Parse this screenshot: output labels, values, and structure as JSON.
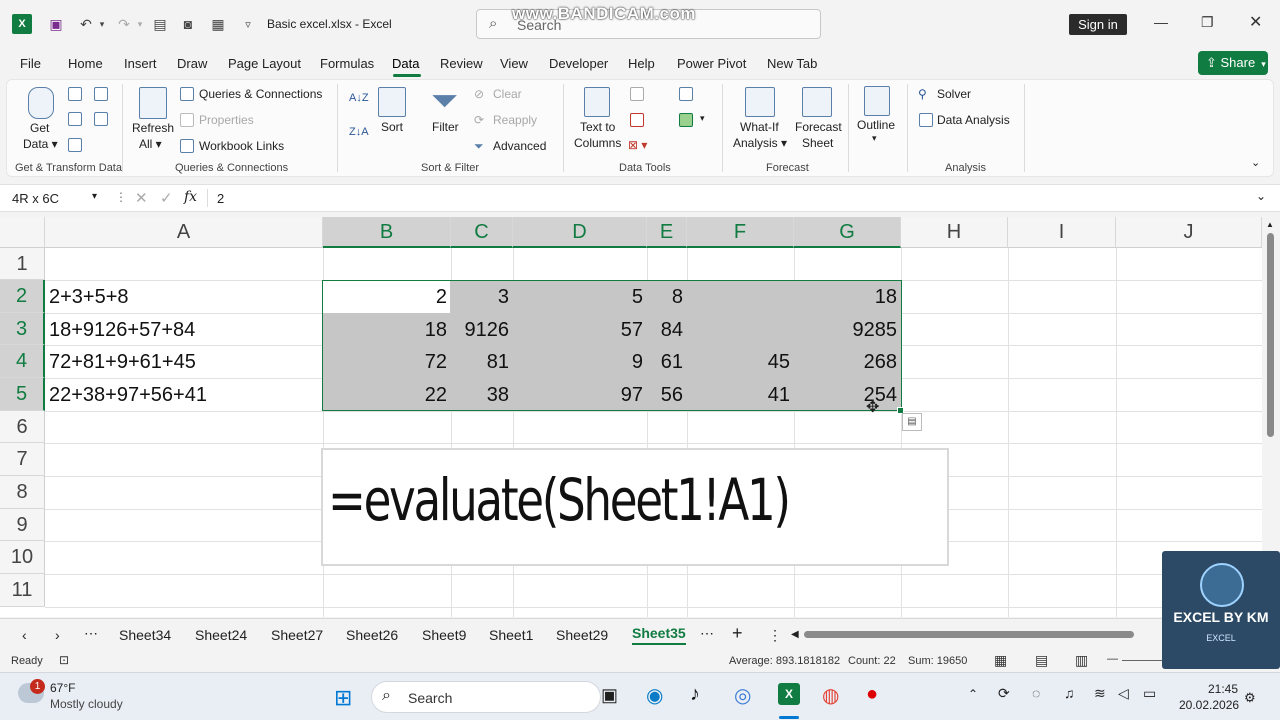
{
  "titlebar": {
    "doc_title": "Basic excel.xlsx  -  Excel",
    "search_placeholder": "Search",
    "watermark": "www.BANDICAM.com",
    "sign_in": "Sign in"
  },
  "menu": {
    "items": [
      "File",
      "Home",
      "Insert",
      "Draw",
      "Page Layout",
      "Formulas",
      "Data",
      "Review",
      "View",
      "Developer",
      "Help",
      "Power Pivot",
      "New Tab"
    ],
    "active": "Data",
    "share": "Share"
  },
  "ribbon": {
    "get_data": "Get Data",
    "refresh_all_1": "Refresh",
    "refresh_all_2": "All",
    "queries_connections": "Queries & Connections",
    "properties": "Properties",
    "workbook_links": "Workbook Links",
    "sort": "Sort",
    "filter": "Filter",
    "clear": "Clear",
    "reapply": "Reapply",
    "advanced": "Advanced",
    "text_to_columns_1": "Text to",
    "text_to_columns_2": "Columns",
    "whatif_1": "What-If",
    "whatif_2": "Analysis",
    "forecast_1": "Forecast",
    "forecast_2": "Sheet",
    "outline": "Outline",
    "solver": "Solver",
    "data_analysis": "Data Analysis",
    "groups": [
      "Get & Transform Data",
      "Queries & Connections",
      "Sort & Filter",
      "Data Tools",
      "Forecast",
      "Analysis"
    ]
  },
  "formula_bar": {
    "name_box": "4R x 6C",
    "fx": "fx",
    "value": "2"
  },
  "grid": {
    "columns": [
      "A",
      "B",
      "C",
      "D",
      "E",
      "F",
      "G",
      "H",
      "I",
      "J"
    ],
    "rows": [
      "1",
      "2",
      "3",
      "4",
      "5",
      "6",
      "7",
      "8",
      "9",
      "10",
      "11"
    ],
    "col_a": [
      "2+3+5+8",
      "18+9126+57+84",
      "72+81+9+61+45",
      "22+38+97+56+41"
    ],
    "data": [
      [
        "2",
        "3",
        "5",
        "8",
        "",
        "18"
      ],
      [
        "18",
        "9126",
        "57",
        "84",
        "",
        "9285"
      ],
      [
        "72",
        "81",
        "9",
        "61",
        "45",
        "268"
      ],
      [
        "22",
        "38",
        "97",
        "56",
        "41",
        "254"
      ]
    ],
    "textbox": "=evaluate(Sheet1!A1)"
  },
  "sheets": {
    "tabs": [
      "Sheet34",
      "Sheet24",
      "Sheet27",
      "Sheet26",
      "Sheet9",
      "Sheet1",
      "Sheet29",
      "Sheet35"
    ],
    "active": "Sheet35"
  },
  "status": {
    "ready": "Ready",
    "average": "Average: 893.1818182",
    "count": "Count: 22",
    "sum": "Sum: 19650"
  },
  "taskbar": {
    "temp": "67°F",
    "weather": "Mostly cloudy",
    "badge": "1",
    "search": "Search",
    "time": "21:45",
    "date": "20.02.2026"
  },
  "logo": {
    "line1": "EXCEL BY KM",
    "line2": "EXCEL"
  },
  "colors": {
    "accent": "#107c41",
    "selection": "#c6c6c6"
  }
}
